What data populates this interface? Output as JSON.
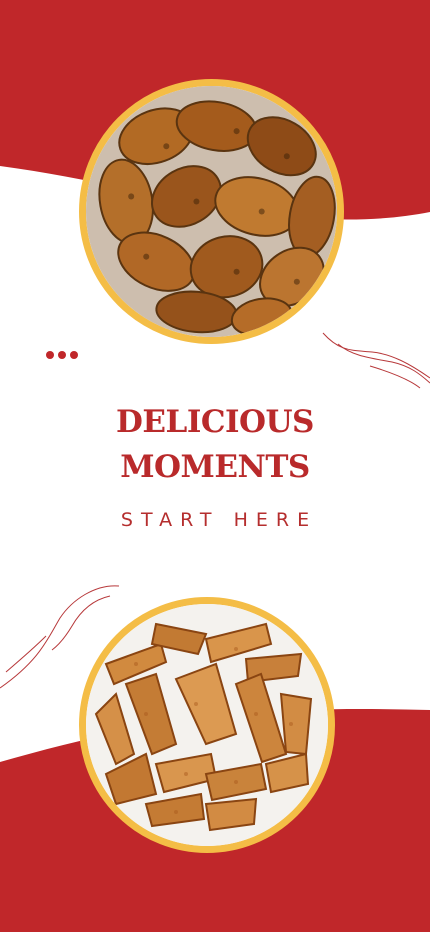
{
  "headline": {
    "line1": "DELICIOUS",
    "line2": "MOMENTS"
  },
  "tagline": "START HERE",
  "images": {
    "top": "fried chicken wings",
    "bottom": "potato wedges"
  },
  "colors": {
    "accent_red": "#c0272a",
    "ring_yellow": "#f4bd46",
    "text_red": "#b92a2b",
    "background": "#ffffff"
  }
}
